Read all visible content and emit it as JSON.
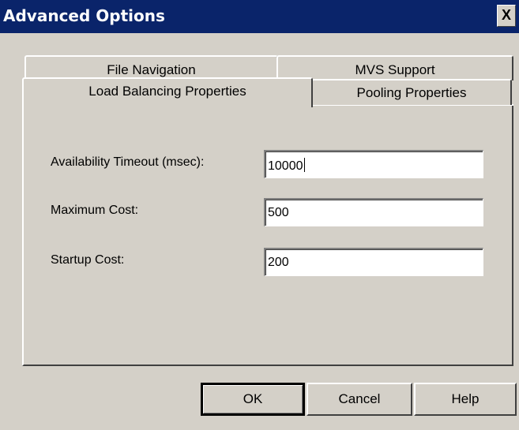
{
  "window": {
    "title": "Advanced Options",
    "close_label": "X"
  },
  "tabs": {
    "file_navigation": "File Navigation",
    "mvs_support": "MVS Support",
    "load_balancing": "Load Balancing Properties",
    "pooling": "Pooling Properties"
  },
  "form": {
    "availability_timeout_label": "Availability Timeout (msec):",
    "availability_timeout_value": "10000",
    "maximum_cost_label": "Maximum Cost:",
    "maximum_cost_value": "500",
    "startup_cost_label": "Startup Cost:",
    "startup_cost_value": "200"
  },
  "buttons": {
    "ok": "OK",
    "cancel": "Cancel",
    "help": "Help"
  },
  "colors": {
    "titlebar": "#0a246a",
    "face": "#d4d0c8"
  }
}
